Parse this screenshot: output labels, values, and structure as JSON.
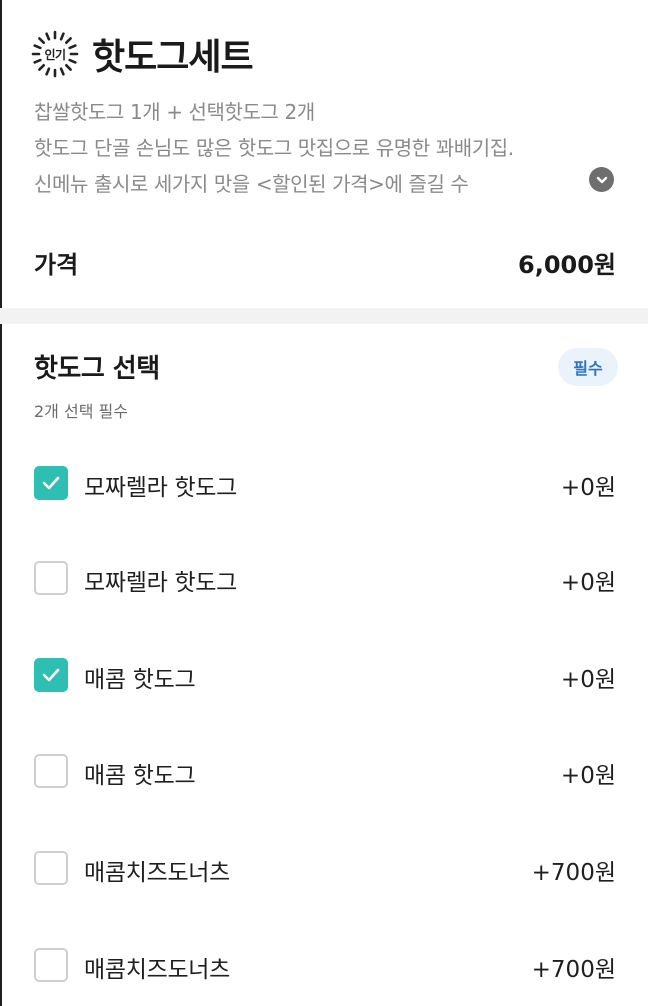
{
  "product": {
    "badge": "인기",
    "title": "핫도그세트",
    "description_lines": [
      "찹쌀핫도그 1개 + 선택핫도그 2개",
      "핫도그 단골 손님도 많은 핫도그 맛집으로 유명한 꽈배기집.",
      "신메뉴 출시로 세가지 맛을 <할인된 가격>에 즐길 수"
    ],
    "expand_icon": "chevron-down-icon",
    "price_label": "가격",
    "price_value": "6,000원"
  },
  "option_group": {
    "title": "핫도그 선택",
    "required_label": "필수",
    "subtitle": "2개 선택 필수",
    "options": [
      {
        "label": "모짜렐라 핫도그",
        "price": "+0원",
        "checked": true
      },
      {
        "label": "모짜렐라 핫도그",
        "price": "+0원",
        "checked": false
      },
      {
        "label": "매콤 핫도그",
        "price": "+0원",
        "checked": true
      },
      {
        "label": "매콤 핫도그",
        "price": "+0원",
        "checked": false
      },
      {
        "label": "매콤치즈도너츠",
        "price": "+700원",
        "checked": false
      },
      {
        "label": "매콤치즈도너츠",
        "price": "+700원",
        "checked": false
      }
    ]
  },
  "colors": {
    "accent": "#2ebfb2",
    "required_badge_bg": "#eaf3fc",
    "required_badge_text": "#2d73c4",
    "muted_text": "#8a8a8a"
  }
}
